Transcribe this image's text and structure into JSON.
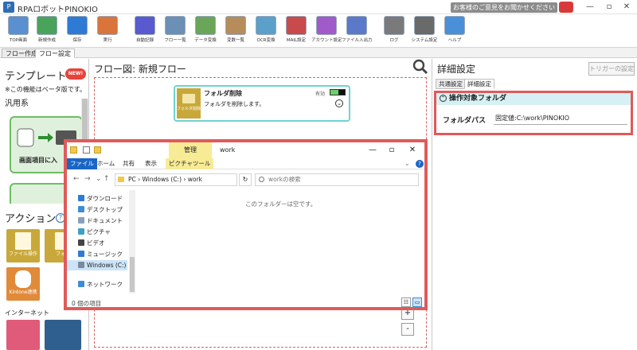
{
  "app": {
    "title": "RPAロボットPINOKIO",
    "feedback_label": "お客様のご意見をお聞かせください",
    "window_controls": [
      "—",
      "▫",
      "✕"
    ]
  },
  "toolbar": {
    "items": [
      {
        "label": "TOP画面",
        "icon": "top-screen-icon",
        "color": "#5a8fd0"
      },
      {
        "label": "新規作成",
        "icon": "new-file-icon",
        "color": "#4aa35a"
      },
      {
        "label": "保存",
        "icon": "save-icon",
        "color": "#2f7ad4"
      },
      {
        "label": "実行",
        "icon": "run-icon",
        "color": "#d9743a"
      },
      {
        "label": "自動記録",
        "icon": "record-icon",
        "color": "#5a5ad0"
      },
      {
        "label": "フロー一覧",
        "icon": "flow-list-icon",
        "color": "#6b8fb5"
      },
      {
        "label": "データ変換",
        "icon": "data-convert-icon",
        "color": "#6aa55a"
      },
      {
        "label": "変数一覧",
        "icon": "variables-icon",
        "color": "#b58c5a"
      },
      {
        "label": "OCR変換",
        "icon": "ocr-icon",
        "color": "#5aa0c9"
      },
      {
        "label": "MAIL設定",
        "icon": "mail-icon",
        "color": "#c94a4a"
      },
      {
        "label": "アカウント設定",
        "icon": "account-icon",
        "color": "#a05ac9"
      },
      {
        "label": "ファイル入出力",
        "icon": "file-io-icon",
        "color": "#5a7ac9"
      },
      {
        "label": "ログ",
        "icon": "log-icon",
        "color": "#7a7a7a"
      },
      {
        "label": "システム設定",
        "icon": "system-settings-icon",
        "color": "#6a6a6a"
      },
      {
        "label": "ヘルプ",
        "icon": "help-icon",
        "color": "#4a90d9"
      }
    ]
  },
  "flow_tabs": [
    "フロー作成",
    "フロー設定"
  ],
  "left_panel": {
    "template_title": "テンプレート",
    "new_badge": "NEW!",
    "beta_note": "※この機能はベータ版です。",
    "general_label": "汎用系",
    "template_caption": "画面項目に入",
    "action_title": "アクション",
    "help_label": "?",
    "actions": [
      {
        "label": "ファイル操作",
        "color": "#c9a83b"
      },
      {
        "label": "フォル",
        "color": "#c9a83b"
      },
      {
        "label": "Kintone連携",
        "color": "#e08a3a"
      }
    ],
    "internet_label": "インターネット"
  },
  "canvas": {
    "heading": "フロー図:  新規フロー",
    "node": {
      "icon_label": "フォルダ削除",
      "title": "フォルダ削除",
      "description": "フォルダを削除します。",
      "toggle_label": "有効"
    },
    "zoom_in": "+",
    "zoom_out": "-"
  },
  "right_panel": {
    "title": "詳細設定",
    "trigger_button": "トリガーの設定",
    "tabs": [
      "共通設定",
      "詳細設定"
    ],
    "section_title": "操作対象フォルダ",
    "folder_path_label": "フォルダパス",
    "folder_path_value": "固定値:C:\\work\\PINOKIO"
  },
  "explorer": {
    "manage_tab": "管理",
    "window_title": "work",
    "ribbon_tabs": [
      "ファイル",
      "ホーム",
      "共有",
      "表示",
      "ピクチャツール"
    ],
    "address": "PC  ›  Windows (C:)  ›  work",
    "search_placeholder": "workの検索",
    "nav_items": [
      {
        "label": "ダウンロード",
        "icon": "download-icon",
        "color": "#2f7ad4"
      },
      {
        "label": "デスクトップ",
        "icon": "desktop-icon",
        "color": "#3c8dd6"
      },
      {
        "label": "ドキュメント",
        "icon": "documents-icon",
        "color": "#8aa0b8"
      },
      {
        "label": "ピクチャ",
        "icon": "pictures-icon",
        "color": "#3ca0c9"
      },
      {
        "label": "ビデオ",
        "icon": "videos-icon",
        "color": "#444444"
      },
      {
        "label": "ミュージック",
        "icon": "music-icon",
        "color": "#2f7ad4"
      },
      {
        "label": "Windows (C:)",
        "icon": "drive-icon",
        "color": "#7a8a9a"
      },
      {
        "label": "ネットワーク",
        "icon": "network-icon",
        "color": "#3c8dd6"
      }
    ],
    "empty_message": "このフォルダーは空です。",
    "status": "0 個の項目"
  }
}
